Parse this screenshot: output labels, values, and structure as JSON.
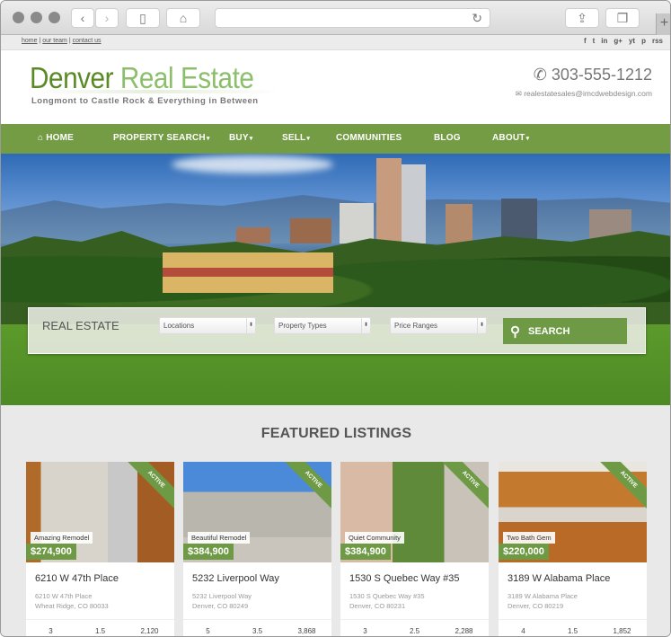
{
  "browser": {
    "back_icon": "‹",
    "forward_icon": "›",
    "sidebar_icon": "▯",
    "home_icon": "⌂",
    "reload_icon": "↻",
    "share_icon": "⇪",
    "tabs_icon": "❐",
    "new_tab_icon": "+"
  },
  "utility": {
    "links": [
      "home",
      "our team",
      "contact us"
    ],
    "separator": "|",
    "social_icons": [
      "f",
      "t",
      "in",
      "g+",
      "yt",
      "p",
      "rss"
    ]
  },
  "header": {
    "logo_dark": "Denver",
    "logo_light": "Real Estate",
    "tagline": "Longmont to Castle Rock & Everything in Between",
    "phone_icon": "✆",
    "phone": "303-555-1212",
    "email_icon": "✉",
    "email": "realestatesales@imcdwebdesign.com"
  },
  "nav": {
    "home_icon": "⌂",
    "items": [
      {
        "label": "HOME",
        "dropdown": false
      },
      {
        "label": "PROPERTY SEARCH",
        "dropdown": true
      },
      {
        "label": "BUY",
        "dropdown": true
      },
      {
        "label": "SELL",
        "dropdown": true
      },
      {
        "label": "COMMUNITIES",
        "dropdown": false
      },
      {
        "label": "BLOG",
        "dropdown": false
      },
      {
        "label": "ABOUT",
        "dropdown": true
      }
    ],
    "caret": "▾"
  },
  "search": {
    "label": "REAL ESTATE",
    "selects": [
      "Locations",
      "Property Types",
      "Price Ranges"
    ],
    "arrow": "⬍",
    "button_label": "SEARCH",
    "button_icon": "🔍",
    "accent": "#6f9a45"
  },
  "featured": {
    "title": "FEATURED LISTINGS",
    "listings": [
      {
        "status": "ACTIVE",
        "tag": "Amazing Remodel",
        "price": "$274,900",
        "title": "6210 W 47th Place",
        "addr1": "6210 W 47th Place",
        "addr2": "Wheat Ridge, CO 80033",
        "beds": "3",
        "baths": "1.5",
        "sqft": "2,120"
      },
      {
        "status": "ACTIVE",
        "tag": "Beautiful Remodel",
        "price": "$384,900",
        "title": "5232 Liverpool Way",
        "addr1": "5232 Liverpool Way",
        "addr2": "Denver, CO 80249",
        "beds": "5",
        "baths": "3.5",
        "sqft": "3,868"
      },
      {
        "status": "ACTIVE",
        "tag": "Quiet Community",
        "price": "$384,900",
        "title": "1530 S Quebec Way #35",
        "addr1": "1530 S Quebec Way #35",
        "addr2": "Denver, CO 80231",
        "beds": "3",
        "baths": "2.5",
        "sqft": "2,288"
      },
      {
        "status": "ACTIVE",
        "tag": "Two Bath Gem",
        "price": "$220,000",
        "title": "3189 W Alabama Place",
        "addr1": "3189 W Alabama Place",
        "addr2": "Denver, CO 80219",
        "beds": "4",
        "baths": "1.5",
        "sqft": "1,852"
      }
    ]
  },
  "colors": {
    "brand_green": "#749c45",
    "logo_dark": "#5a8a26",
    "logo_light": "#8cbf6b"
  }
}
